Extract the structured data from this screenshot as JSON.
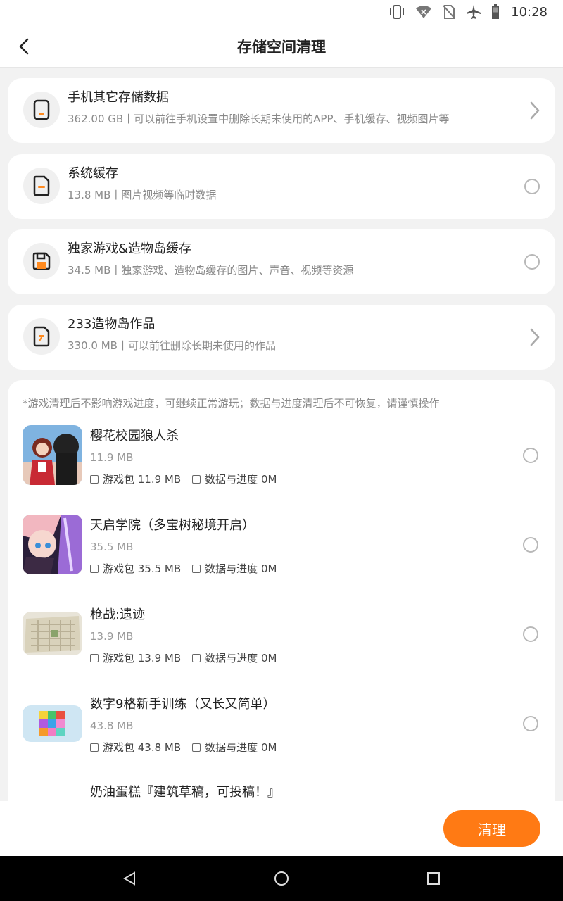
{
  "status_bar": {
    "time": "10:28",
    "icons": [
      "vibrate-icon",
      "wifi-icon",
      "no-sim-icon",
      "airplane-mode-icon",
      "battery-icon"
    ]
  },
  "header": {
    "title": "存储空间清理",
    "back_icon": "back-arrow-icon"
  },
  "categories": [
    {
      "title": "手机其它存储数据",
      "subtitle": "362.00 GB丨可以前往手机设置中删除长期未使用的APP、手机缓存、视频图片等",
      "icon": "phone-storage-icon",
      "action": "chevron"
    },
    {
      "title": "系统缓存",
      "subtitle": "13.8 MB丨图片视频等临时数据",
      "icon": "document-icon",
      "action": "radio"
    },
    {
      "title": "独家游戏&造物岛缓存",
      "subtitle": "34.5 MB丨独家游戏、造物岛缓存的图片、声音、视频等资源",
      "icon": "save-disk-icon",
      "action": "radio"
    },
    {
      "title": "233造物岛作品",
      "subtitle": "330.0 MB丨可以前往删除长期未使用的作品",
      "icon": "hammer-file-icon",
      "action": "chevron"
    }
  ],
  "games_section": {
    "notice": "*游戏清理后不影响游戏进度，可继续正常游玩；数据与进度清理后不可恢复，请谨慎操作",
    "games": [
      {
        "name": "樱花校园狼人杀",
        "size": "11.9 MB",
        "package_label": "游戏包 11.9 MB",
        "data_label": "数据与进度 0M"
      },
      {
        "name": "天启学院（多宝树秘境开启）",
        "size": "35.5 MB",
        "package_label": "游戏包 35.5 MB",
        "data_label": "数据与进度 0M"
      },
      {
        "name": "枪战:遗迹",
        "size": "13.9 MB",
        "package_label": "游戏包 13.9 MB",
        "data_label": "数据与进度 0M"
      },
      {
        "name": "数字9格新手训练（又长又简单）",
        "size": "43.8 MB",
        "package_label": "游戏包 43.8 MB",
        "data_label": "数据与进度 0M"
      }
    ],
    "partial_next_name": "奶油蛋糕『建筑草稿，可投稿！』"
  },
  "bottom": {
    "clean_label": "清理"
  },
  "colors": {
    "accent": "#ff7a14",
    "background": "#f2f2f2",
    "card": "#ffffff",
    "icon_orange": "#ff8a1f"
  },
  "nav_bar": {
    "icons": [
      "nav-back-icon",
      "nav-home-icon",
      "nav-recents-icon"
    ]
  }
}
